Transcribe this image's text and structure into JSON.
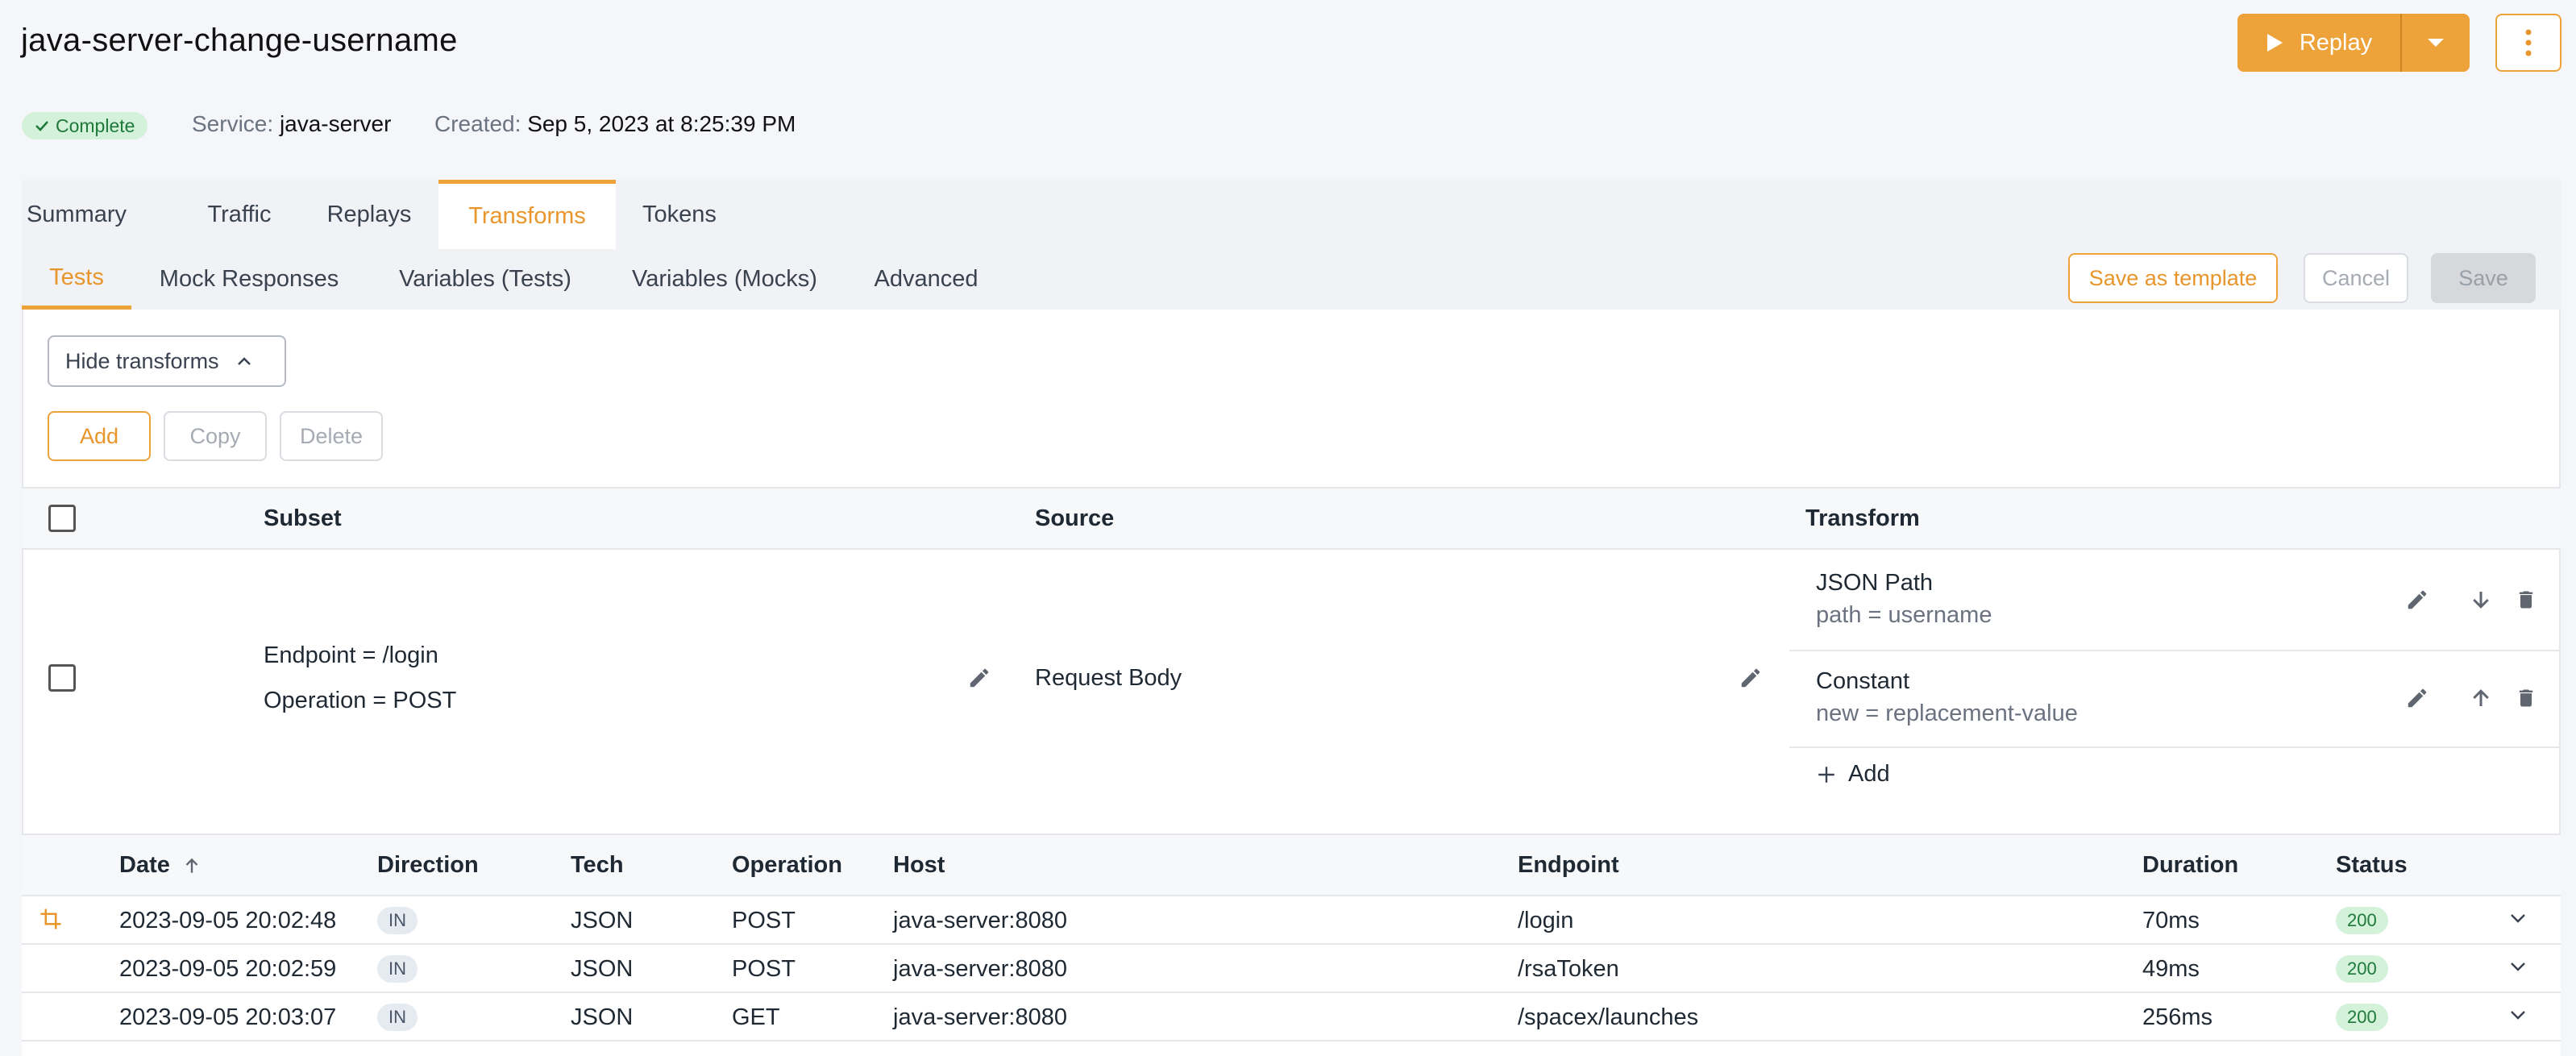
{
  "header": {
    "title": "java-server-change-username",
    "replay_label": "Replay"
  },
  "meta": {
    "status": "Complete",
    "service_label": "Service:",
    "service_value": "java-server",
    "created_label": "Created:",
    "created_value": "Sep 5, 2023 at 8:25:39 PM"
  },
  "tabs": [
    {
      "label": "Summary"
    },
    {
      "label": "Traffic"
    },
    {
      "label": "Replays"
    },
    {
      "label": "Transforms"
    },
    {
      "label": "Tokens"
    }
  ],
  "subtabs": [
    {
      "label": "Tests"
    },
    {
      "label": "Mock Responses"
    },
    {
      "label": "Variables (Tests)"
    },
    {
      "label": "Variables (Mocks)"
    },
    {
      "label": "Advanced"
    }
  ],
  "actions": {
    "save_template": "Save as template",
    "cancel": "Cancel",
    "save": "Save",
    "hide_transforms": "Hide transforms",
    "add": "Add",
    "copy": "Copy",
    "delete": "Delete"
  },
  "transform_table": {
    "headers": {
      "subset": "Subset",
      "source": "Source",
      "transform": "Transform"
    },
    "row": {
      "subset_1": "Endpoint = /login",
      "subset_2": "Operation = POST",
      "source": "Request Body",
      "transforms": [
        {
          "name": "JSON Path",
          "detail": "path = username"
        },
        {
          "name": "Constant",
          "detail": "new = replacement-value"
        }
      ],
      "add_label": "Add"
    }
  },
  "traffic_table": {
    "headers": {
      "date": "Date",
      "direction": "Direction",
      "tech": "Tech",
      "operation": "Operation",
      "host": "Host",
      "endpoint": "Endpoint",
      "duration": "Duration",
      "status": "Status"
    },
    "rows": [
      {
        "date": "2023-09-05 20:02:48",
        "direction": "IN",
        "tech": "JSON",
        "operation": "POST",
        "host": "java-server:8080",
        "endpoint": "/login",
        "duration": "70ms",
        "status": "200"
      },
      {
        "date": "2023-09-05 20:02:59",
        "direction": "IN",
        "tech": "JSON",
        "operation": "POST",
        "host": "java-server:8080",
        "endpoint": "/rsaToken",
        "duration": "49ms",
        "status": "200"
      },
      {
        "date": "2023-09-05 20:03:07",
        "direction": "IN",
        "tech": "JSON",
        "operation": "GET",
        "host": "java-server:8080",
        "endpoint": "/spacex/launches",
        "duration": "256ms",
        "status": "200"
      }
    ]
  },
  "colors": {
    "accent": "#eea33a",
    "success_bg": "#d4f1da",
    "success_text": "#1d7a3a"
  },
  "icons": {
    "replay": "play-icon",
    "caret": "caret-down-icon",
    "more": "kebab-icon",
    "check": "check-icon",
    "chevron": "chevron-up-icon",
    "edit": "pencil-icon",
    "down": "arrow-down-icon",
    "up": "arrow-up-icon",
    "trash": "trash-icon",
    "plus": "plus-icon",
    "sort": "arrow-up-icon",
    "expand": "chevron-down-icon",
    "crop": "crop-icon"
  }
}
